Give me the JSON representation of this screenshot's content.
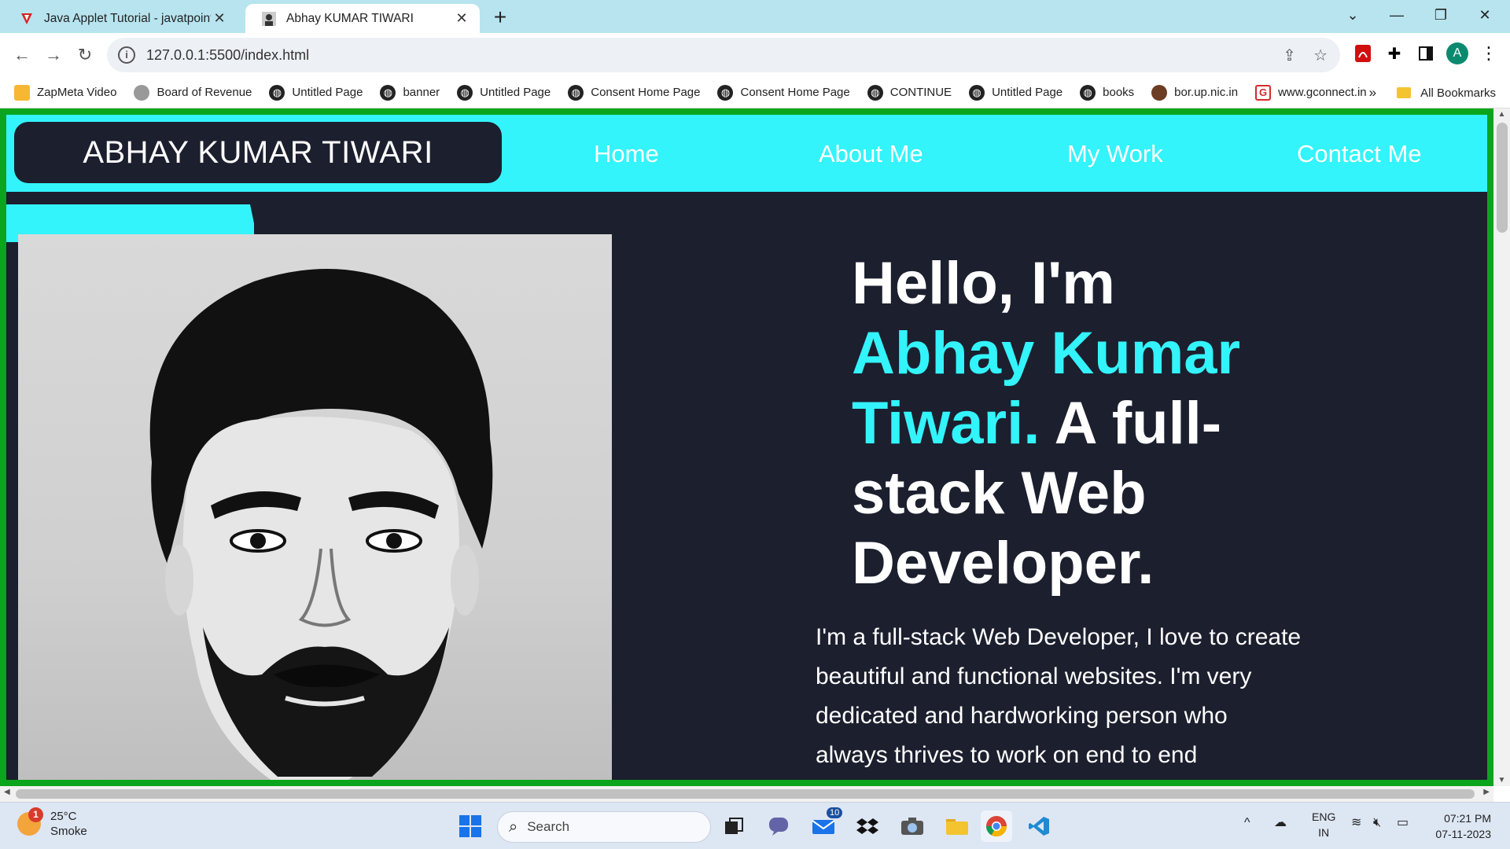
{
  "browser": {
    "tabs": [
      {
        "title": "Java Applet Tutorial - javatpoint",
        "favicon": "javatpoint-logo-icon",
        "active": false
      },
      {
        "title": "Abhay KUMAR TIWARI",
        "favicon": "profile-photo-icon",
        "active": true
      }
    ],
    "new_tab": "+",
    "url": "127.0.0.1:5500/index.html",
    "bookmarks": [
      {
        "label": "ZapMeta Video"
      },
      {
        "label": "Board of Revenue"
      },
      {
        "label": "Untitled Page"
      },
      {
        "label": "banner"
      },
      {
        "label": "Untitled Page"
      },
      {
        "label": "Consent Home Page"
      },
      {
        "label": "Consent Home Page"
      },
      {
        "label": "CONTINUE"
      },
      {
        "label": "Untitled Page"
      },
      {
        "label": "books"
      },
      {
        "label": "bor.up.nic.in"
      },
      {
        "label": "www.gconnect.in"
      }
    ],
    "bookmarks_overflow": "»",
    "all_bookmarks": "All Bookmarks",
    "profile_initial": "A"
  },
  "site": {
    "brand": "ABHAY KUMAR TIWARI",
    "nav": [
      "Home",
      "About Me",
      "My Work",
      "Contact Me"
    ],
    "hero": {
      "line1": "Hello, I'm",
      "name": "Abhay Kumar Tiwari.",
      "tagline": " A full-stack Web Developer."
    },
    "intro": "I'm a full-stack Web Developer, I love to create beautiful and functional websites. I'm very dedicated and hardworking person who always thrives to work on end to end",
    "colors": {
      "accent": "#33f3fb",
      "background": "#1c1f2e",
      "frame": "#0aa51c"
    }
  },
  "taskbar": {
    "weather_temp": "25°C",
    "weather_desc": "Smoke",
    "weather_badge": "1",
    "search_placeholder": "Search",
    "mail_badge": "10",
    "lang1": "ENG",
    "lang2": "IN",
    "time": "07:21 PM",
    "date": "07-11-2023"
  }
}
